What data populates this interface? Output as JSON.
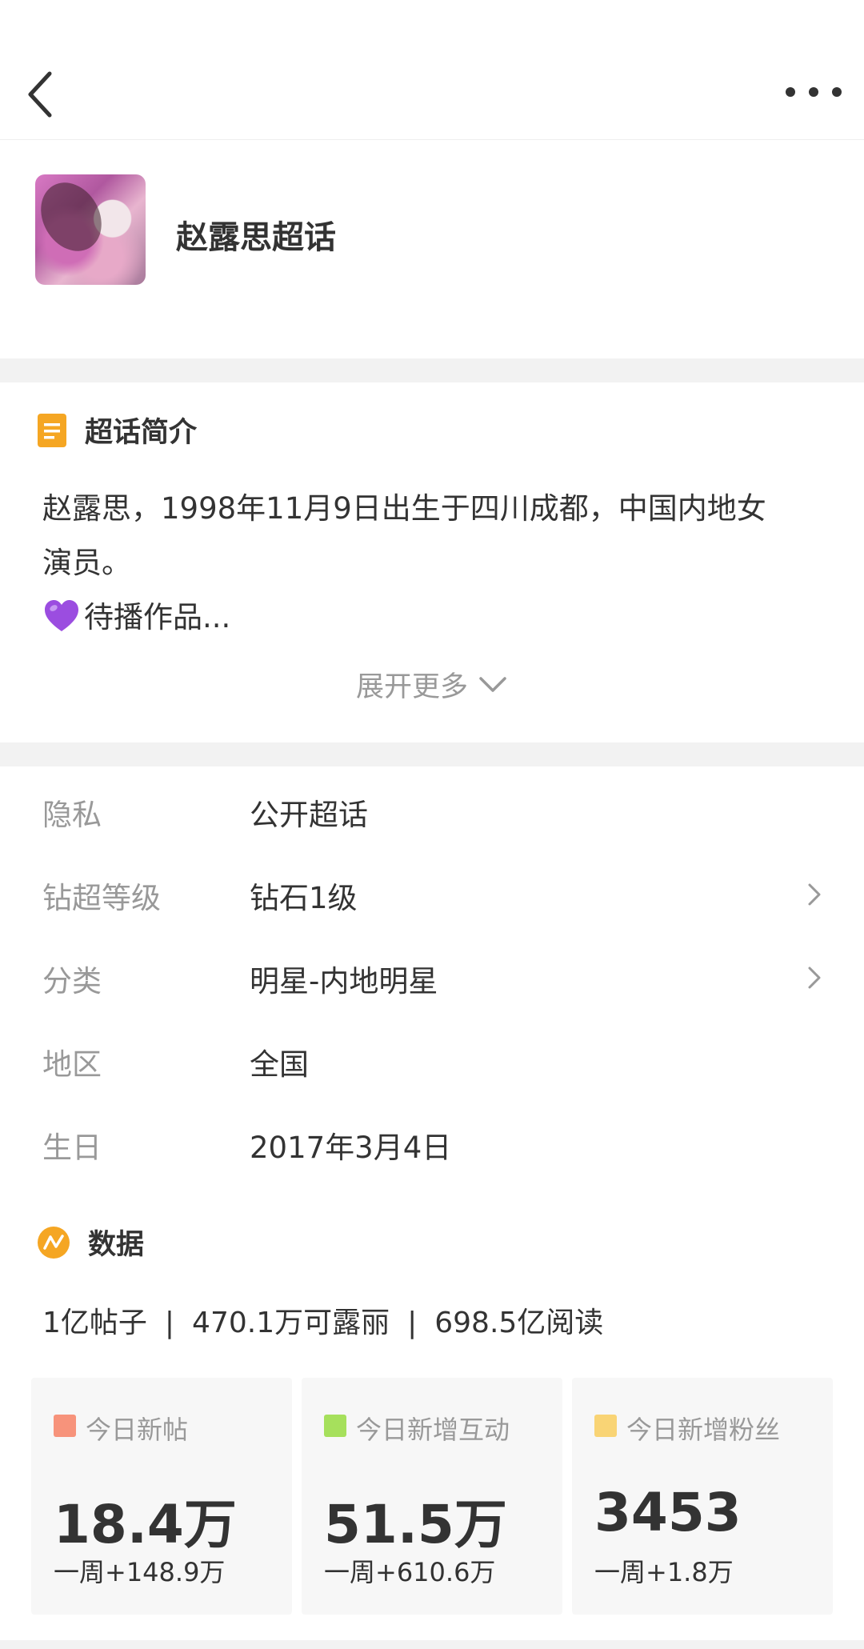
{
  "header": {
    "title": "赵露思超话"
  },
  "intro": {
    "section_title": "超话简介",
    "line1": "赵露思，1998年11月9日出生于四川成都，中国内地女",
    "line2": "演员。",
    "line3": "待播作品...",
    "heart_icon": "purple-heart-icon",
    "expand_label": "展开更多"
  },
  "info": {
    "rows": [
      {
        "key": "隐私",
        "value": "公开超话",
        "has_arrow": false
      },
      {
        "key": "钻超等级",
        "value": "钻石1级",
        "has_arrow": true
      },
      {
        "key": "分类",
        "value": "明星-内地明星",
        "has_arrow": true
      },
      {
        "key": "地区",
        "value": "全国",
        "has_arrow": false
      },
      {
        "key": "生日",
        "value": "2017年3月4日",
        "has_arrow": false
      }
    ]
  },
  "data": {
    "section_title": "数据",
    "posts": "1亿帖子",
    "fans": "470.1万可露丽",
    "reads": "698.5亿阅读",
    "separator": "|",
    "cards": [
      {
        "label": "今日新帖",
        "value": "18.4万",
        "week": "一周+148.9万",
        "color": "#f7937b"
      },
      {
        "label": "今日新增互动",
        "value": "51.5万",
        "week": "一周+610.6万",
        "color": "#a6e05c"
      },
      {
        "label": "今日新增粉丝",
        "value": "3453",
        "week": "一周+1.8万",
        "color": "#f9d475"
      }
    ]
  },
  "colors": {
    "accent_orange": "#f5a623",
    "page_gap": "#f2f2f2",
    "label_gray": "#999999",
    "text_dark": "#333333"
  }
}
